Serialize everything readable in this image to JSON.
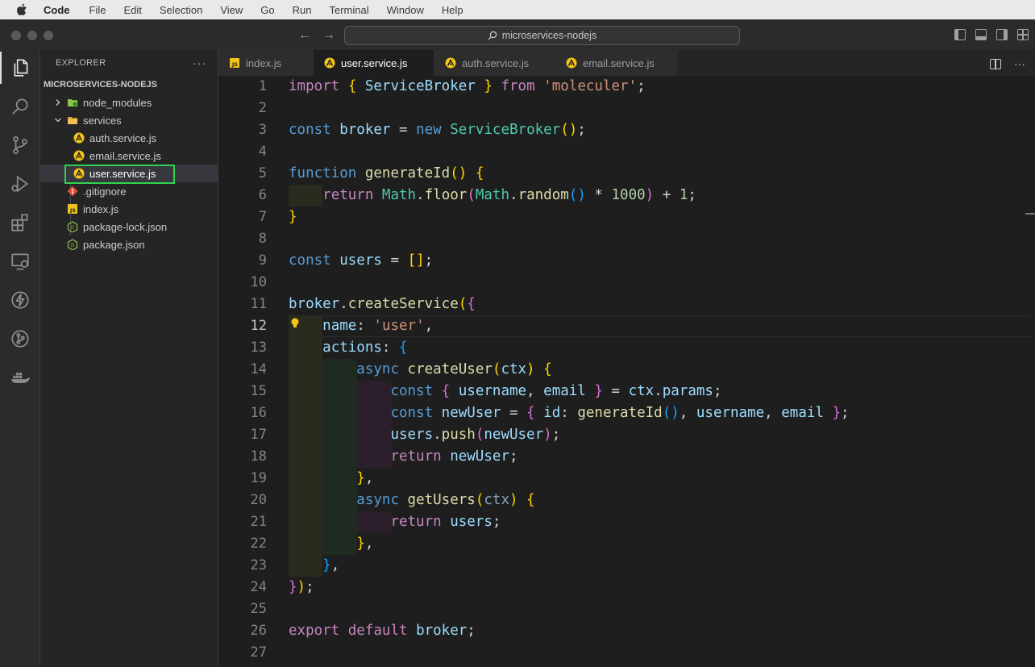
{
  "menubar": {
    "app": "Code",
    "items": [
      "File",
      "Edit",
      "Selection",
      "View",
      "Go",
      "Run",
      "Terminal",
      "Window",
      "Help"
    ]
  },
  "titlebar": {
    "search_text": "microservices-nodejs"
  },
  "sidebar": {
    "header": "EXPLORER",
    "more": "···",
    "root": "MICROSERVICES-NODEJS",
    "items": [
      {
        "label": "node_modules",
        "type": "folder",
        "icon": "folder-node-icon"
      },
      {
        "label": "services",
        "type": "folder-open",
        "icon": "folder-icon"
      },
      {
        "label": "auth.service.js",
        "type": "file",
        "icon": "moleculer-icon"
      },
      {
        "label": "email.service.js",
        "type": "file",
        "icon": "moleculer-icon"
      },
      {
        "label": "user.service.js",
        "type": "file",
        "icon": "moleculer-icon"
      },
      {
        "label": ".gitignore",
        "type": "file",
        "icon": "git-icon"
      },
      {
        "label": "index.js",
        "type": "file",
        "icon": "js-icon"
      },
      {
        "label": "package-lock.json",
        "type": "file",
        "icon": "node-icon"
      },
      {
        "label": "package.json",
        "type": "file",
        "icon": "node-icon"
      }
    ]
  },
  "tabs": [
    {
      "label": "index.js",
      "icon": "js-icon"
    },
    {
      "label": "user.service.js",
      "icon": "moleculer-icon",
      "active": true
    },
    {
      "label": "auth.service.js",
      "icon": "moleculer-icon"
    },
    {
      "label": "email.service.js",
      "icon": "moleculer-icon"
    }
  ],
  "editor": {
    "current_line": 12,
    "line_numbers": [
      "1",
      "2",
      "3",
      "4",
      "5",
      "6",
      "7",
      "8",
      "9",
      "10",
      "11",
      "12",
      "13",
      "14",
      "15",
      "16",
      "17",
      "18",
      "19",
      "20",
      "21",
      "22",
      "23",
      "24",
      "25",
      "26",
      "27"
    ],
    "code": {
      "l1": {
        "t1": "import",
        "t2": "{",
        "t3": "ServiceBroker",
        "t4": "}",
        "t5": "from",
        "t6": "'moleculer'",
        "t7": ";"
      },
      "l3": {
        "t1": "const",
        "t2": "broker",
        "t3": "=",
        "t4": "new",
        "t5": "ServiceBroker",
        "t6": "()",
        "t7": ";"
      },
      "l5": {
        "t1": "function",
        "t2": "generateId",
        "t3": "()",
        "t4": "{"
      },
      "l6": {
        "t1": "return",
        "t2": "Math",
        "t3": ".",
        "t4": "floor",
        "t5": "(",
        "t6": "Math",
        "t7": ".",
        "t8": "random",
        "t9": "()",
        "t10": "*",
        "t11": "1000",
        "t12": ")",
        "t13": "+",
        "t14": "1",
        "t15": ";"
      },
      "l7": {
        "t1": "}"
      },
      "l9": {
        "t1": "const",
        "t2": "users",
        "t3": "=",
        "t4": "[]",
        "t5": ";"
      },
      "l11": {
        "t1": "broker",
        "t2": ".",
        "t3": "createService",
        "t4": "(",
        "t5": "{"
      },
      "l12": {
        "t1": "name",
        "t2": ":",
        "t3": "'user'",
        "t4": ","
      },
      "l13": {
        "t1": "actions",
        "t2": ":",
        "t3": "{"
      },
      "l14": {
        "t1": "async",
        "t2": "createUser",
        "t3": "(",
        "t4": "ctx",
        "t5": ")",
        "t6": "{"
      },
      "l15": {
        "t1": "const",
        "t2": "{",
        "t3": "username",
        "t4": ",",
        "t5": "email",
        "t6": "}",
        "t7": "=",
        "t8": "ctx",
        "t9": ".",
        "t10": "params",
        "t11": ";"
      },
      "l16": {
        "t1": "const",
        "t2": "newUser",
        "t3": "=",
        "t4": "{",
        "t5": "id",
        "t6": ":",
        "t7": "generateId",
        "t8": "()",
        "t9": ",",
        "t10": "username",
        "t11": ",",
        "t12": "email",
        "t13": "}",
        "t14": ";"
      },
      "l17": {
        "t1": "users",
        "t2": ".",
        "t3": "push",
        "t4": "(",
        "t5": "newUser",
        "t6": ")",
        "t7": ";"
      },
      "l18": {
        "t1": "return",
        "t2": "newUser",
        "t3": ";"
      },
      "l19": {
        "t1": "}",
        "t2": ","
      },
      "l20": {
        "t1": "async",
        "t2": "getUsers",
        "t3": "(",
        "t4": "ctx",
        "t5": ")",
        "t6": "{"
      },
      "l21": {
        "t1": "return",
        "t2": "users",
        "t3": ";"
      },
      "l22": {
        "t1": "}",
        "t2": ","
      },
      "l23": {
        "t1": "}",
        "t2": ","
      },
      "l24": {
        "t1": "}",
        "t2": ")",
        "t3": ";"
      },
      "l26": {
        "t1": "export",
        "t2": "default",
        "t3": "broker",
        "t4": ";"
      }
    }
  },
  "colors": {
    "selection_outline": "#2fd34f",
    "indent_level1": "#2a2a1f",
    "indent_level2": "#1f2a20",
    "indent_level3": "#2a1f2a"
  }
}
